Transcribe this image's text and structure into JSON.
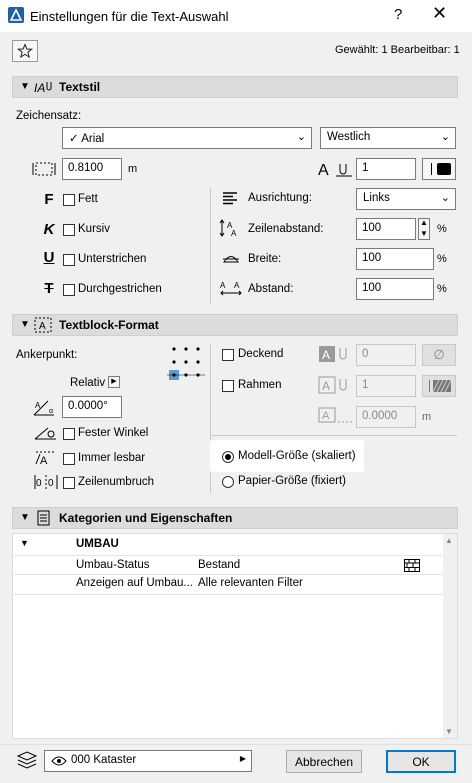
{
  "window": {
    "title": "Einstellungen für die Text-Auswahl",
    "help": "?",
    "close": "✕"
  },
  "status": "Gewählt: 1 Bearbeitbar: 1",
  "textstil": {
    "title": "Textstil",
    "zeichensatz_label": "Zeichensatz:",
    "font_value": "✓ Arial",
    "script_value": "Westlich",
    "size_value": "0.8100",
    "size_unit": "m",
    "pen_value": "1",
    "fett": "Fett",
    "kursiv": "Kursiv",
    "unterstrichen": "Unterstrichen",
    "durchgestrichen": "Durchgestrichen",
    "ausrichtung_label": "Ausrichtung:",
    "ausrichtung_value": "Links",
    "zeilenabstand_label": "Zeilenabstand:",
    "zeilenabstand_value": "100",
    "breite_label": "Breite:",
    "breite_value": "100",
    "abstand_label": "Abstand:",
    "abstand_value": "100",
    "percent": "%"
  },
  "textblock": {
    "title": "Textblock-Format",
    "ankerpunkt_label": "Ankerpunkt:",
    "relativ_label": "Relativ",
    "angle_value": "0.0000°",
    "fester_winkel": "Fester Winkel",
    "immer_lesbar": "Immer lesbar",
    "zeilenumbruch": "Zeilenumbruch",
    "deckend": "Deckend",
    "deckend_value": "0",
    "rahmen": "Rahmen",
    "rahmen_value": "1",
    "offset_value": "0.0000",
    "offset_unit": "m",
    "modell_groesse": "Modell-Größe (skaliert)",
    "papier_groesse": "Papier-Größe (fixiert)"
  },
  "kategorien": {
    "title": "Kategorien und Eigenschaften",
    "group": "UMBAU",
    "rows": [
      {
        "name": "Umbau-Status",
        "value": "Bestand"
      },
      {
        "name": "Anzeigen auf Umbau...",
        "value": "Alle relevanten Filter"
      }
    ]
  },
  "footer": {
    "layer": "000 Kataster",
    "cancel": "Abbrechen",
    "ok": "OK"
  }
}
